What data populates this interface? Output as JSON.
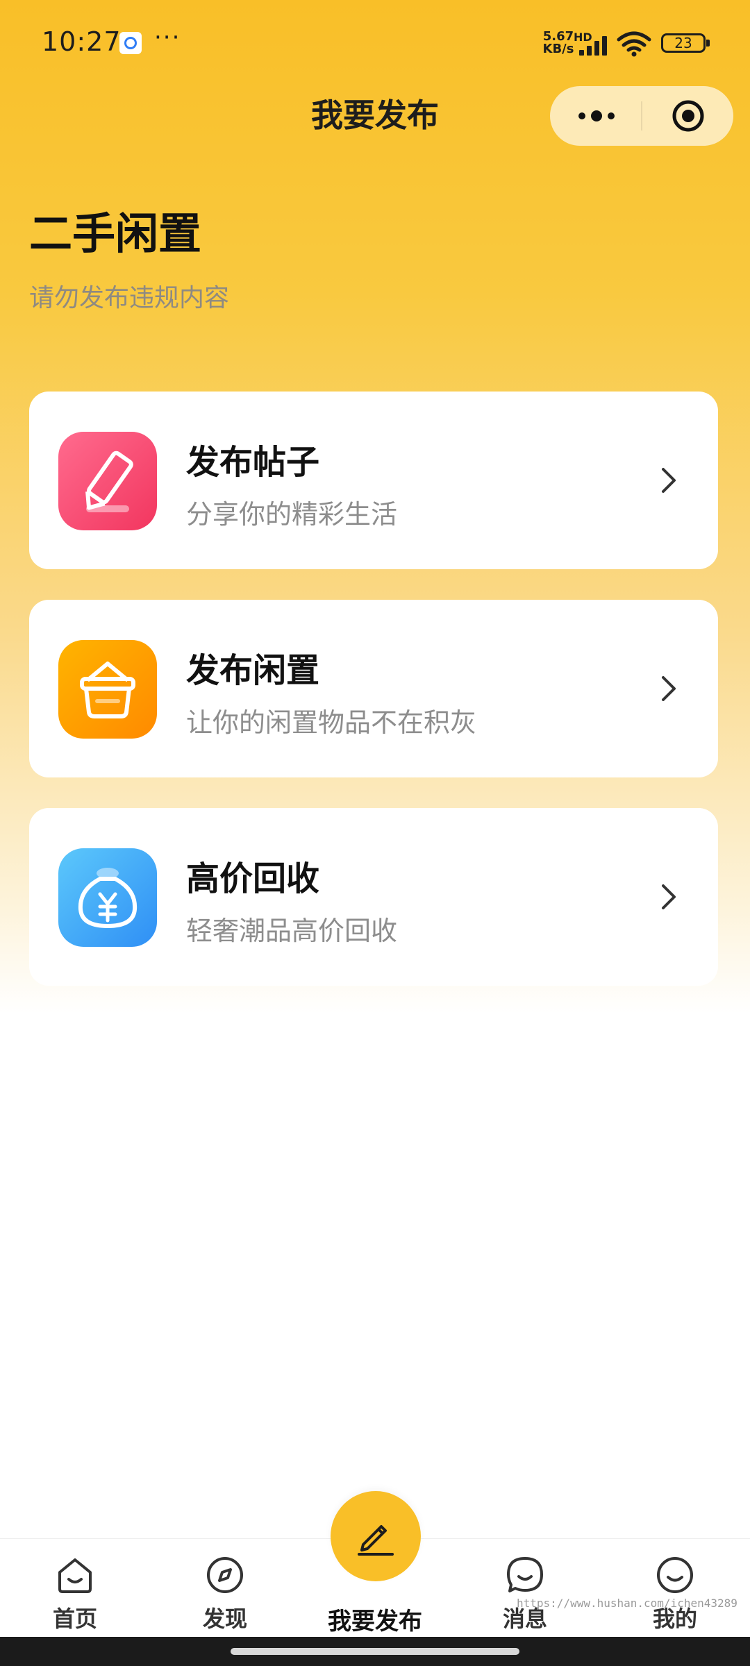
{
  "status_bar": {
    "time": "10:27",
    "net_speed_value": "5.67",
    "net_speed_unit": "KB/s",
    "network_type": "HD",
    "battery": "23",
    "more": "···"
  },
  "nav": {
    "title": "我要发布"
  },
  "header": {
    "title": "二手闲置",
    "subtitle": "请勿发布违规内容"
  },
  "cards": [
    {
      "title": "发布帖子",
      "subtitle": "分享你的精彩生活",
      "icon": "pencil-icon",
      "color": "#F2365F"
    },
    {
      "title": "发布闲置",
      "subtitle": "让你的闲置物品不在积灰",
      "icon": "basket-icon",
      "color": "#FF8A00"
    },
    {
      "title": "高价回收",
      "subtitle": "轻奢潮品高价回收",
      "icon": "yuan-bag-icon",
      "color": "#2F8FF5"
    }
  ],
  "tabbar": {
    "tabs": [
      {
        "label": "首页",
        "icon": "home-icon"
      },
      {
        "label": "发现",
        "icon": "compass-icon"
      },
      {
        "label": "我要发布",
        "icon": "pencil-icon"
      },
      {
        "label": "消息",
        "icon": "message-icon"
      },
      {
        "label": "我的",
        "icon": "smile-icon"
      }
    ],
    "accent": "#F9BF28"
  },
  "watermark": "https://www.hushan.com/ichen43289"
}
